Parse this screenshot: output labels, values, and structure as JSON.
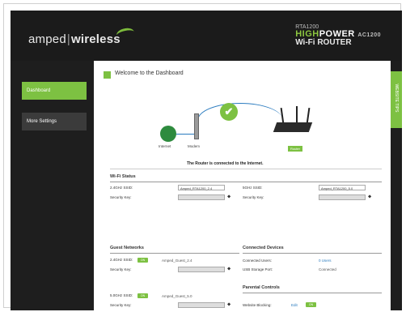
{
  "brand": {
    "logo_left": "amped",
    "logo_sep": "|",
    "logo_right": "wireless",
    "model": "RTA1200",
    "product_hi": "HIGH",
    "product_power": "POWER",
    "product_suffix": "AC1200",
    "product_line2_a": "Wi-Fi",
    "product_line2_b": "ROUTER"
  },
  "sidebar": {
    "items": [
      {
        "label": "Dashboard",
        "active": true
      },
      {
        "label": "More Settings",
        "active": false
      }
    ]
  },
  "side_tab": {
    "label": "WEBSITE TIPS"
  },
  "welcome": {
    "title": "Welcome to the Dashboard"
  },
  "diagram": {
    "internet_label": "Internet",
    "modem_label": "Modem",
    "router_label": "Router",
    "status_text": "The Router is connected to the Internet."
  },
  "wifi_status": {
    "title": "Wi-Fi Status",
    "ssid_24_label": "2.4GHz SSID:",
    "ssid_24_value": "Amped_RTA1200_2.4",
    "ssid_5_label": "5GHz SSID:",
    "ssid_5_value": "Amped_RTA1200_5.0",
    "security_key_label": "Security Key:",
    "security_key_label2": "Security Key:"
  },
  "guest": {
    "title": "Guest Networks",
    "ssid_24_label": "2.4GHz SSID:",
    "toggle_24": "ON",
    "ssid_24_value": "Amped_Guest_2.4",
    "security_key_label": "Security Key:",
    "ssid_5_label": "5.0GHz SSID:",
    "toggle_5": "ON",
    "ssid_5_value": "Amped_Guest_5.0",
    "security_key_label2": "Security Key:"
  },
  "devices": {
    "title": "Connected Devices",
    "users_label": "Connected Users:",
    "users_value": "0 Users",
    "usb_label": "USB Storage Port:",
    "usb_value": "Connected"
  },
  "parental": {
    "title": "Parental Controls",
    "blocking_label": "Website Blocking:",
    "edit_label": "Edit",
    "toggle": "ON"
  },
  "icons": {
    "eye": "eye-icon",
    "check": "check-icon"
  },
  "colors": {
    "accent": "#7dc142",
    "dark": "#1e1e1e",
    "link": "#2a7bbf"
  }
}
